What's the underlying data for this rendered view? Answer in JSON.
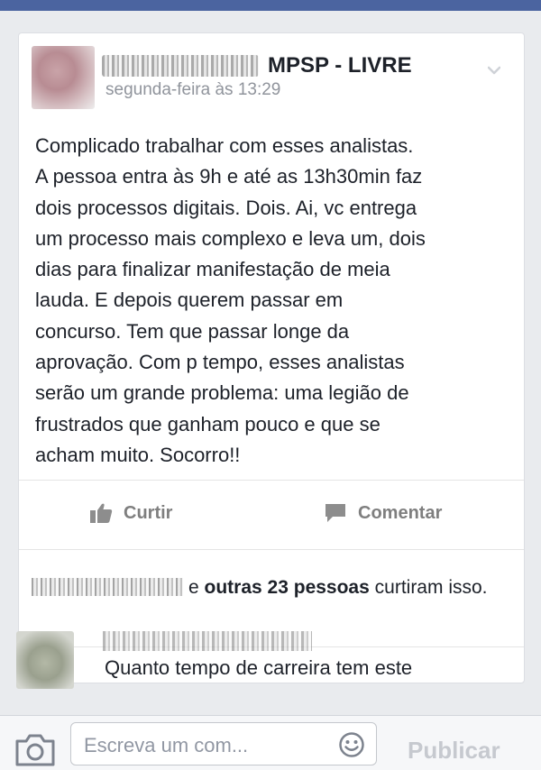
{
  "post": {
    "group_name": "MPSP - LIVRE",
    "timestamp": "segunda-feira às 13:29",
    "lines": [
      "Complicado trabalhar com esses analistas.",
      "A pessoa entra às 9h e até as 13h30min  faz",
      "dois processos digitais. Dois. Ai, vc entrega",
      "um processo mais complexo e leva um, dois",
      "dias para finalizar manifestação de meia",
      "lauda. E depois querem passar em",
      "concurso. Tem que passar longe da",
      "aprovação. Com p tempo, esses analistas",
      "serão um grande problema: uma legião de",
      "frustrados que ganham pouco e que se",
      "acham muito. Socorro!!"
    ]
  },
  "actions": {
    "like_label": "Curtir",
    "comment_label": "Comentar"
  },
  "likes": {
    "prefix": "e",
    "others": "outras 23 pessoas",
    "suffix": "curtiram isso."
  },
  "comment": {
    "text": "Quanto tempo de carreira tem este"
  },
  "composer": {
    "placeholder": "Escreva um com...",
    "publish_label": "Publicar"
  }
}
